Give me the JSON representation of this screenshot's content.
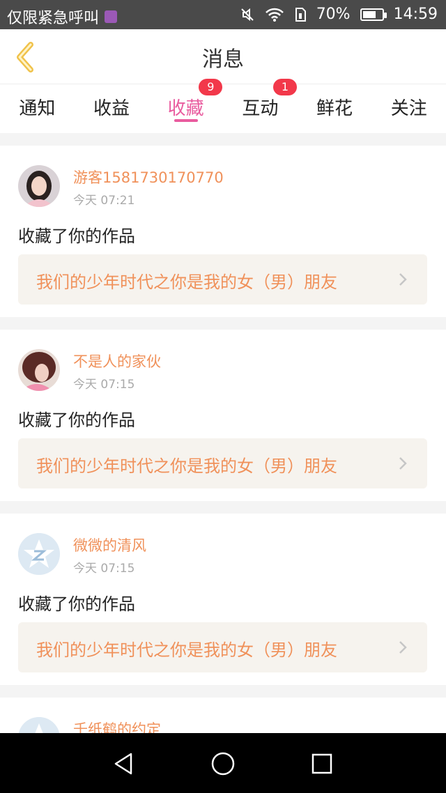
{
  "status_bar": {
    "carrier": "仅限紧急呼叫",
    "battery": "70%",
    "battery_level": 0.7,
    "time": "14:59"
  },
  "header": {
    "title": "消息"
  },
  "tabs": [
    {
      "label": "通知",
      "badge": null,
      "active": false
    },
    {
      "label": "收益",
      "badge": null,
      "active": false
    },
    {
      "label": "收藏",
      "badge": "9",
      "active": true
    },
    {
      "label": "互动",
      "badge": "1",
      "active": false
    },
    {
      "label": "鲜花",
      "badge": null,
      "active": false
    },
    {
      "label": "关注",
      "badge": null,
      "active": false
    }
  ],
  "messages": [
    {
      "name": "游客1581730170770",
      "time": "今天 07:21",
      "action": "收藏了你的作品",
      "work_title": "我们的少年时代之你是我的女（男）朋友"
    },
    {
      "name": "不是人的家伙",
      "time": "今天 07:15",
      "action": "收藏了你的作品",
      "work_title": "我们的少年时代之你是我的女（男）朋友"
    },
    {
      "name": "微微的清风",
      "time": "今天 07:15",
      "action": "收藏了你的作品",
      "work_title": "我们的少年时代之你是我的女（男）朋友"
    },
    {
      "name": "千纸鹤的约定"
    }
  ],
  "colors": {
    "accent": "#e95c9f",
    "badge": "#f2384a",
    "orange": "#f0915a"
  }
}
